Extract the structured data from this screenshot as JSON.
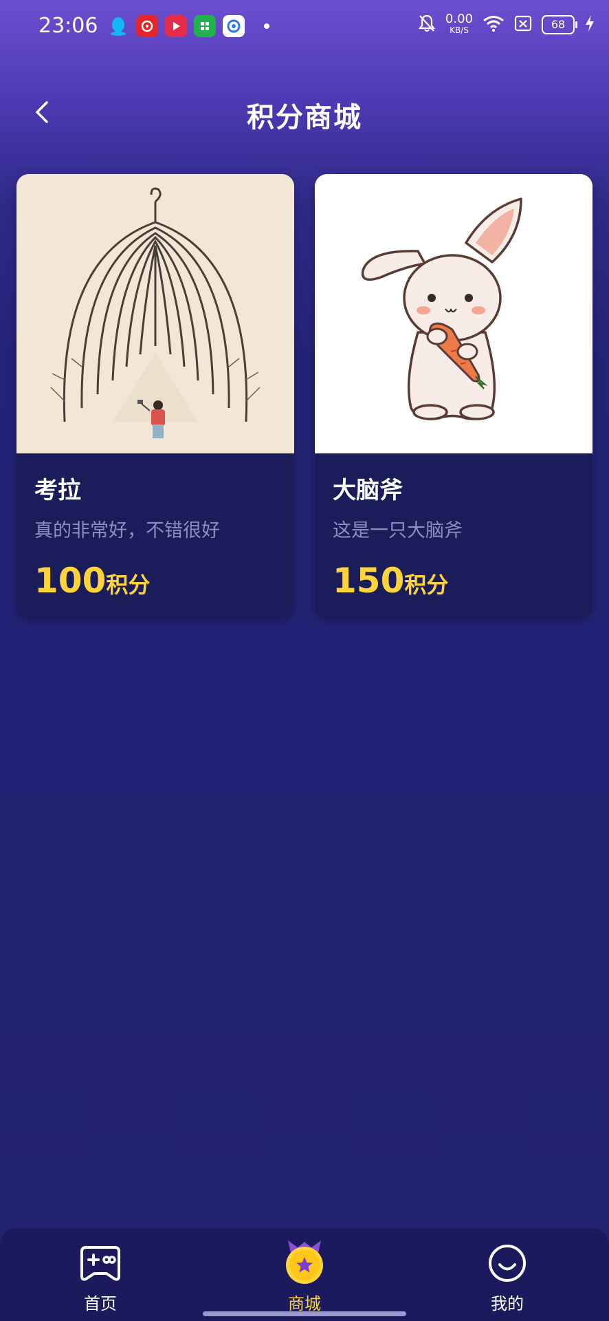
{
  "status_bar": {
    "time": "23:06",
    "net_speed": "0.00",
    "net_unit": "KB/S",
    "battery": "68"
  },
  "header": {
    "title": "积分商城"
  },
  "products": [
    {
      "name": "考拉",
      "description": "真的非常好，不错很好",
      "points": "100",
      "points_unit": "积分"
    },
    {
      "name": "大脑斧",
      "description": "这是一只大脑斧",
      "points": "150",
      "points_unit": "积分"
    }
  ],
  "bottom_nav": {
    "items": [
      {
        "label": "首页",
        "icon": "gamepad-icon"
      },
      {
        "label": "商城",
        "icon": "star-medal-icon",
        "active": true
      },
      {
        "label": "我的",
        "icon": "smiley-icon"
      }
    ],
    "active_color": "#ffd43b"
  },
  "colors": {
    "accent_yellow": "#ffd43b",
    "card_bg": "#1b1c5a",
    "page_bg": "#21226f"
  }
}
